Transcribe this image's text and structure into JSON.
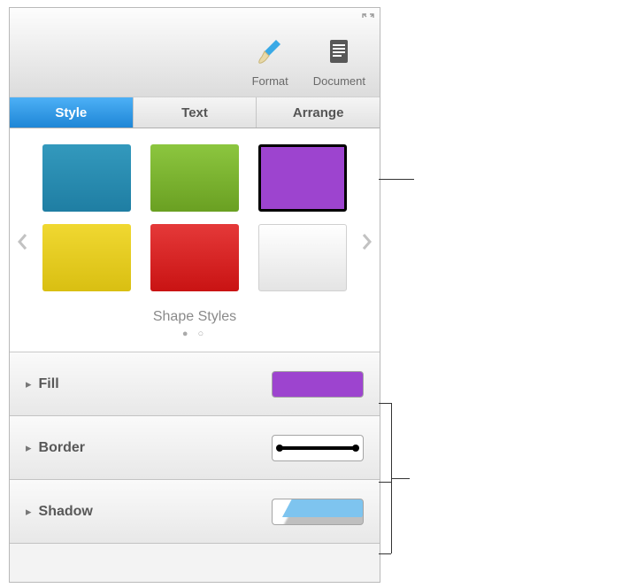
{
  "toolbar": {
    "format_label": "Format",
    "document_label": "Document"
  },
  "tabs": {
    "style": "Style",
    "text": "Text",
    "arrange": "Arrange",
    "active": "style"
  },
  "gallery": {
    "title": "Shape Styles",
    "swatches_row1": [
      "teal",
      "green",
      "purple"
    ],
    "swatches_row2": [
      "yellow",
      "red",
      "white"
    ],
    "selected": "purple"
  },
  "props": {
    "fill": {
      "label": "Fill",
      "color": "#9d44cf"
    },
    "border": {
      "label": "Border",
      "style": "rough-line"
    },
    "shadow": {
      "label": "Shadow",
      "style": "drop-shadow-blue"
    }
  }
}
